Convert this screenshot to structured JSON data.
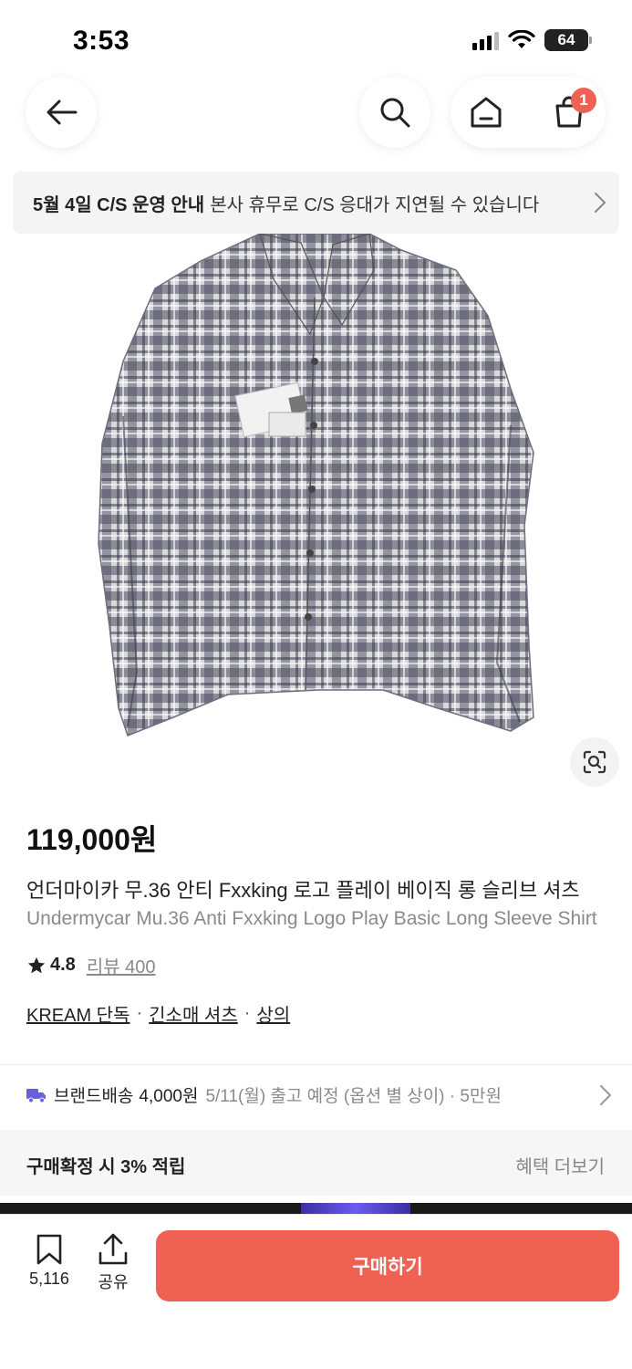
{
  "status_bar": {
    "time": "3:53",
    "battery": "64"
  },
  "header": {
    "cart_badge": "1",
    "icons": [
      "back-arrow-icon",
      "search-icon",
      "home-icon",
      "cart-icon"
    ]
  },
  "notice": {
    "title": "5월 4일 C/S 운영 안내",
    "text": "본사 휴무로 C/S 응대가 지연될 수 있습니다"
  },
  "product": {
    "price": "119,000원",
    "name_ko": "언더마이카 무.36 안티 Fxxking 로고 플레이 베이직 롱 슬리브 셔츠",
    "name_en": "Undermycar Mu.36 Anti Fxxking Logo Play Basic Long Sleeve Shirt",
    "rating": "4.8",
    "review_label": "리뷰 400",
    "categories": [
      "KREAM 단독",
      "긴소매 셔츠",
      "상의"
    ]
  },
  "shipping": {
    "label": "브랜드배송",
    "price": "4,000원",
    "detail": "5/11(월) 출고 예정 (옵션 별 상이) · 5만원"
  },
  "benefit": {
    "title": "구매확정 시 3% 적립",
    "link": "혜택 더보기"
  },
  "bottom_bar": {
    "bookmark_count": "5,116",
    "share_label": "공유",
    "buy_label": "구매하기"
  },
  "colors": {
    "accent": "#ef6253",
    "notice_bg": "#f4f4f4",
    "delivery_icon": "#6b5fe0"
  }
}
